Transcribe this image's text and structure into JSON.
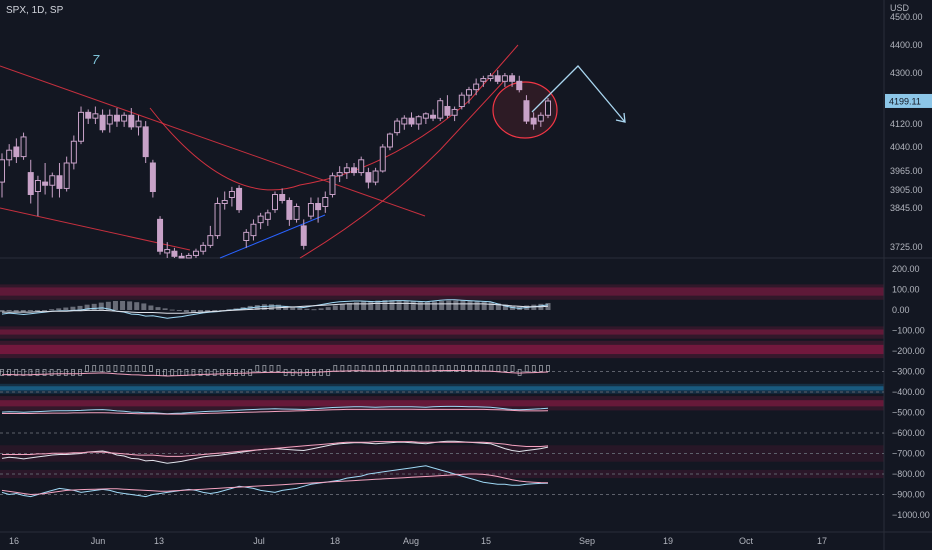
{
  "header": {
    "symbol": "SPX, 1D, SP"
  },
  "annotation_text": "7",
  "colors": {
    "background": "#131722",
    "candle": "#c8a2c8",
    "trendline": "#f23645",
    "blue_line": "#2962ff",
    "arrow": "#a9d6f0",
    "price_box": "#8cc6e8",
    "osc_light": "#9fd8f5",
    "osc_pink": "#f4a3c0",
    "band_pink": "#8b1a45",
    "band_blue": "#1b5f86"
  },
  "chart_data": [
    {
      "type": "candlestick",
      "title": "SPX, 1D, SP",
      "currency": "USD",
      "last_price": "4199.11",
      "y_ticks": [
        "4500.00",
        "4400.00",
        "4300.00",
        "4120.00",
        "4040.00",
        "3965.00",
        "3905.00",
        "3845.00",
        "3725.00"
      ],
      "ylim": [
        3660,
        4520
      ],
      "x_ticks": [
        "16",
        "Jun",
        "13",
        "Jul",
        "18",
        "Aug",
        "15",
        "Sep",
        "19",
        "Oct",
        "17"
      ],
      "candles": [
        {
          "o": 3930,
          "h": 4020,
          "l": 3880,
          "c": 4000
        },
        {
          "o": 4000,
          "h": 4050,
          "l": 3980,
          "c": 4030
        },
        {
          "o": 4040,
          "h": 4070,
          "l": 3990,
          "c": 4010
        },
        {
          "o": 4010,
          "h": 4090,
          "l": 4000,
          "c": 4075
        },
        {
          "o": 3960,
          "h": 4000,
          "l": 3860,
          "c": 3890
        },
        {
          "o": 3900,
          "h": 3950,
          "l": 3820,
          "c": 3935
        },
        {
          "o": 3930,
          "h": 3990,
          "l": 3890,
          "c": 3920
        },
        {
          "o": 3920,
          "h": 3960,
          "l": 3880,
          "c": 3950
        },
        {
          "o": 3950,
          "h": 3990,
          "l": 3880,
          "c": 3910
        },
        {
          "o": 3910,
          "h": 4010,
          "l": 3900,
          "c": 3990
        },
        {
          "o": 3990,
          "h": 4080,
          "l": 3970,
          "c": 4060
        },
        {
          "o": 4060,
          "h": 4180,
          "l": 4050,
          "c": 4160
        },
        {
          "o": 4160,
          "h": 4170,
          "l": 4120,
          "c": 4140
        },
        {
          "o": 4140,
          "h": 4180,
          "l": 4120,
          "c": 4155
        },
        {
          "o": 4150,
          "h": 4170,
          "l": 4090,
          "c": 4100
        },
        {
          "o": 4120,
          "h": 4170,
          "l": 4090,
          "c": 4150
        },
        {
          "o": 4150,
          "h": 4175,
          "l": 4110,
          "c": 4130
        },
        {
          "o": 4130,
          "h": 4160,
          "l": 4110,
          "c": 4150
        },
        {
          "o": 4150,
          "h": 4175,
          "l": 4100,
          "c": 4110
        },
        {
          "o": 4110,
          "h": 4150,
          "l": 4080,
          "c": 4130
        },
        {
          "o": 4110,
          "h": 4130,
          "l": 3990,
          "c": 4010
        },
        {
          "o": 3990,
          "h": 4000,
          "l": 3880,
          "c": 3900
        },
        {
          "o": 3810,
          "h": 3820,
          "l": 3680,
          "c": 3700
        },
        {
          "o": 3690,
          "h": 3740,
          "l": 3660,
          "c": 3710
        },
        {
          "o": 3700,
          "h": 3720,
          "l": 3660,
          "c": 3670
        },
        {
          "o": 3670,
          "h": 3690,
          "l": 3630,
          "c": 3650
        },
        {
          "o": 3660,
          "h": 3690,
          "l": 3630,
          "c": 3675
        },
        {
          "o": 3675,
          "h": 3715,
          "l": 3660,
          "c": 3700
        },
        {
          "o": 3700,
          "h": 3740,
          "l": 3680,
          "c": 3730
        },
        {
          "o": 3730,
          "h": 3790,
          "l": 3720,
          "c": 3760
        },
        {
          "o": 3760,
          "h": 3880,
          "l": 3750,
          "c": 3860
        },
        {
          "o": 3860,
          "h": 3900,
          "l": 3840,
          "c": 3870
        },
        {
          "o": 3880,
          "h": 3915,
          "l": 3850,
          "c": 3900
        },
        {
          "o": 3910,
          "h": 3920,
          "l": 3830,
          "c": 3840
        },
        {
          "o": 3745,
          "h": 3780,
          "l": 3720,
          "c": 3770
        },
        {
          "o": 3760,
          "h": 3810,
          "l": 3745,
          "c": 3795
        },
        {
          "o": 3800,
          "h": 3830,
          "l": 3780,
          "c": 3820
        },
        {
          "o": 3810,
          "h": 3840,
          "l": 3790,
          "c": 3830
        },
        {
          "o": 3840,
          "h": 3900,
          "l": 3830,
          "c": 3890
        },
        {
          "o": 3890,
          "h": 3910,
          "l": 3860,
          "c": 3870
        },
        {
          "o": 3870,
          "h": 3880,
          "l": 3790,
          "c": 3810
        },
        {
          "o": 3810,
          "h": 3860,
          "l": 3800,
          "c": 3850
        },
        {
          "o": 3790,
          "h": 3810,
          "l": 3710,
          "c": 3730
        },
        {
          "o": 3820,
          "h": 3880,
          "l": 3810,
          "c": 3860
        },
        {
          "o": 3860,
          "h": 3880,
          "l": 3800,
          "c": 3840
        },
        {
          "o": 3850,
          "h": 3900,
          "l": 3830,
          "c": 3880
        },
        {
          "o": 3890,
          "h": 3960,
          "l": 3880,
          "c": 3950
        },
        {
          "o": 3950,
          "h": 3980,
          "l": 3930,
          "c": 3960
        },
        {
          "o": 3960,
          "h": 3990,
          "l": 3940,
          "c": 3975
        },
        {
          "o": 3975,
          "h": 3990,
          "l": 3950,
          "c": 3960
        },
        {
          "o": 3960,
          "h": 4010,
          "l": 3950,
          "c": 4000
        },
        {
          "o": 3960,
          "h": 3975,
          "l": 3910,
          "c": 3930
        },
        {
          "o": 3930,
          "h": 3975,
          "l": 3920,
          "c": 3965
        },
        {
          "o": 3965,
          "h": 4050,
          "l": 3960,
          "c": 4040
        },
        {
          "o": 4040,
          "h": 4090,
          "l": 4030,
          "c": 4085
        },
        {
          "o": 4090,
          "h": 4140,
          "l": 4080,
          "c": 4130
        },
        {
          "o": 4120,
          "h": 4150,
          "l": 4100,
          "c": 4140
        },
        {
          "o": 4140,
          "h": 4160,
          "l": 4110,
          "c": 4120
        },
        {
          "o": 4120,
          "h": 4150,
          "l": 4100,
          "c": 4145
        },
        {
          "o": 4140,
          "h": 4160,
          "l": 4120,
          "c": 4155
        },
        {
          "o": 4150,
          "h": 4170,
          "l": 4130,
          "c": 4140
        },
        {
          "o": 4140,
          "h": 4210,
          "l": 4130,
          "c": 4200
        },
        {
          "o": 4180,
          "h": 4220,
          "l": 4140,
          "c": 4150
        },
        {
          "o": 4150,
          "h": 4180,
          "l": 4130,
          "c": 4170
        },
        {
          "o": 4180,
          "h": 4230,
          "l": 4170,
          "c": 4220
        },
        {
          "o": 4220,
          "h": 4250,
          "l": 4190,
          "c": 4240
        },
        {
          "o": 4240,
          "h": 4280,
          "l": 4220,
          "c": 4260
        },
        {
          "o": 4270,
          "h": 4290,
          "l": 4250,
          "c": 4280
        },
        {
          "o": 4280,
          "h": 4300,
          "l": 4270,
          "c": 4290
        },
        {
          "o": 4290,
          "h": 4310,
          "l": 4260,
          "c": 4270
        },
        {
          "o": 4270,
          "h": 4300,
          "l": 4250,
          "c": 4290
        },
        {
          "o": 4290,
          "h": 4300,
          "l": 4250,
          "c": 4270
        },
        {
          "o": 4270,
          "h": 4290,
          "l": 4230,
          "c": 4240
        },
        {
          "o": 4200,
          "h": 4220,
          "l": 4120,
          "c": 4130
        },
        {
          "o": 4140,
          "h": 4160,
          "l": 4100,
          "c": 4120
        },
        {
          "o": 4130,
          "h": 4160,
          "l": 4110,
          "c": 4150
        },
        {
          "o": 4150,
          "h": 4210,
          "l": 4140,
          "c": 4199
        }
      ]
    },
    {
      "type": "oscillator",
      "y_ticks": [
        "200.00",
        "100.00",
        "0.00",
        "−100.00",
        "−200.00",
        "−300.00",
        "−400.00",
        "−500.00",
        "−600.00",
        "−700.00",
        "−800.00",
        "−900.00",
        "−1000.00"
      ],
      "ylim": [
        -1050,
        220
      ],
      "histogram": [
        -10,
        -5,
        -8,
        -12,
        -6,
        -4,
        -2,
        4,
        8,
        12,
        16,
        20,
        26,
        30,
        36,
        40,
        44,
        44,
        42,
        38,
        32,
        22,
        14,
        8,
        2,
        -4,
        -10,
        -14,
        -12,
        -10,
        -6,
        -2,
        4,
        8,
        14,
        20,
        24,
        28,
        28,
        26,
        20,
        14,
        10,
        6,
        4,
        8,
        14,
        22,
        28,
        34,
        38,
        42,
        44,
        46,
        48,
        48,
        46,
        44,
        42,
        40,
        40,
        42,
        44,
        46,
        46,
        46,
        44,
        42,
        40,
        38,
        32,
        26,
        22,
        18,
        22,
        26,
        30,
        34
      ],
      "main_line": [
        -20,
        -15,
        -18,
        -22,
        -18,
        -14,
        -10,
        -6,
        -4,
        -4,
        -2,
        0,
        6,
        8,
        10,
        4,
        -6,
        -10,
        -20,
        -22,
        -30,
        -28,
        -34,
        -40,
        -36,
        -32,
        -26,
        -20,
        -14,
        -10,
        -8,
        -4,
        0,
        4,
        8,
        12,
        16,
        18,
        20,
        18,
        16,
        14,
        12,
        18,
        24,
        30,
        36,
        40,
        42,
        44,
        44,
        42,
        40,
        42,
        44,
        46,
        46,
        44,
        42,
        40,
        44,
        48,
        50,
        50,
        48,
        46,
        44,
        42,
        40,
        30,
        20,
        12,
        8,
        12,
        16,
        20,
        26
      ],
      "secondary_line": [
        -10,
        -10,
        -10,
        -10,
        -10,
        -8,
        -8,
        -6,
        -6,
        -6,
        -4,
        -4,
        -2,
        -2,
        -2,
        -4,
        -6,
        -8,
        -10,
        -12,
        -12,
        -12,
        -14,
        -16,
        -16,
        -16,
        -14,
        -12,
        -10,
        -8,
        -6,
        -4,
        -2,
        0,
        2,
        4,
        6,
        8,
        10,
        12,
        14,
        16,
        18,
        20,
        22,
        24,
        26,
        28,
        30,
        30,
        30,
        30,
        32,
        32,
        32,
        32,
        32,
        32,
        30,
        30,
        30,
        30,
        30,
        30,
        30,
        30,
        30,
        30,
        28,
        26,
        24,
        20,
        18,
        16,
        16,
        16,
        18
      ],
      "lower_line_a": [
        -890,
        -900,
        -895,
        -905,
        -910,
        -900,
        -890,
        -880,
        -870,
        -875,
        -880,
        -890,
        -885,
        -880,
        -875,
        -880,
        -890,
        -895,
        -900,
        -905,
        -910,
        -900,
        -895,
        -890,
        -885,
        -880,
        -875,
        -880,
        -890,
        -895,
        -890,
        -880,
        -870,
        -860,
        -865,
        -870,
        -880,
        -885,
        -890,
        -880,
        -875,
        -870,
        -860,
        -850,
        -845,
        -840,
        -835,
        -830,
        -820,
        -815,
        -810,
        -800,
        -795,
        -790,
        -785,
        -780,
        -775,
        -770,
        -765,
        -760,
        -770,
        -780,
        -790,
        -800,
        -810,
        -820,
        -830,
        -840,
        -845,
        -850,
        -850,
        -855,
        -855,
        -850,
        -848,
        -846,
        -845
      ],
      "lower_line_b": [
        -880,
        -885,
        -890,
        -895,
        -900,
        -898,
        -895,
        -890,
        -885,
        -880,
        -878,
        -876,
        -875,
        -874,
        -873,
        -872,
        -872,
        -874,
        -876,
        -878,
        -880,
        -882,
        -884,
        -884,
        -882,
        -880,
        -878,
        -876,
        -874,
        -872,
        -870,
        -868,
        -866,
        -864,
        -862,
        -860,
        -858,
        -856,
        -854,
        -852,
        -850,
        -848,
        -846,
        -844,
        -842,
        -840,
        -838,
        -836,
        -834,
        -832,
        -830,
        -828,
        -826,
        -824,
        -822,
        -820,
        -818,
        -816,
        -814,
        -812,
        -810,
        -808,
        -806,
        -804,
        -802,
        -800,
        -800,
        -802,
        -806,
        -812,
        -820,
        -828,
        -834,
        -838,
        -840,
        -842,
        -843
      ]
    }
  ]
}
